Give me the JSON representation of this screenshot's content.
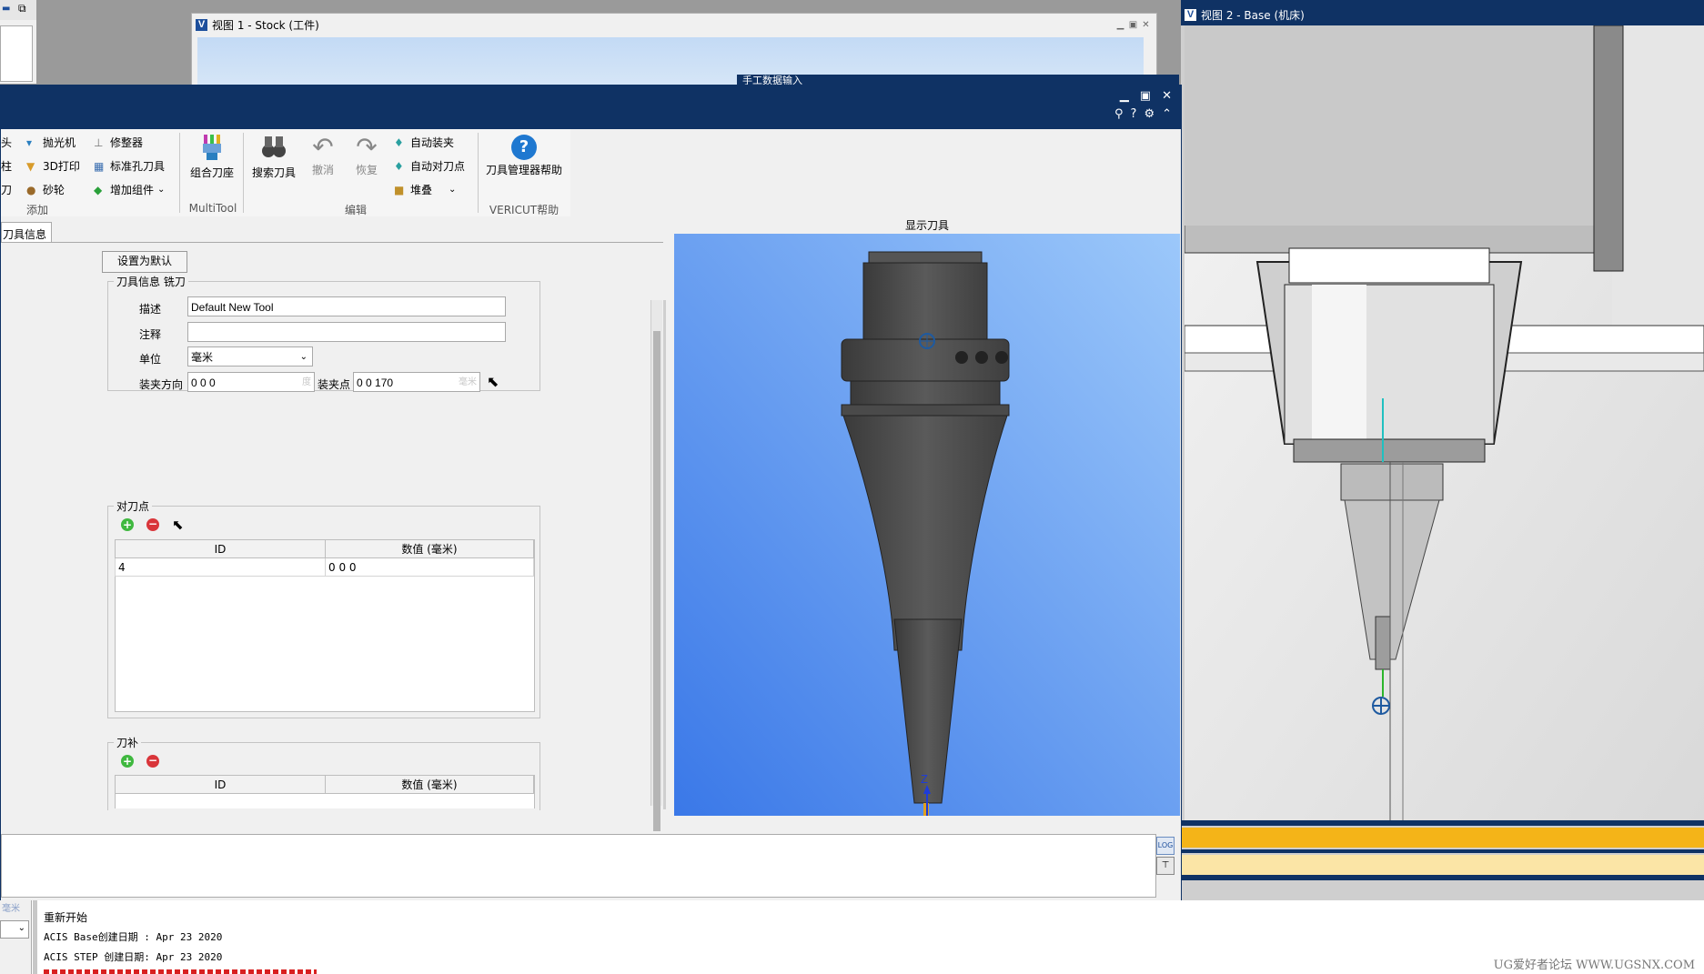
{
  "background_window_view1": {
    "title": "视图 1 - Stock (工件)"
  },
  "background_window_behind": {
    "title": "手工数据输入"
  },
  "view2": {
    "title": "视图 2 - Base (机床)"
  },
  "tool_manager": {
    "toolbar": {
      "group_add": {
        "label": "添加",
        "items": [
          "头",
          "柱",
          "刀",
          "抛光机",
          "3D打印",
          "砂轮",
          "修整器",
          "标准孔刀具",
          "增加组件"
        ]
      },
      "group_multitool": {
        "label": "MultiTool",
        "combo_holder": "组合刀座"
      },
      "group_edit": {
        "label": "编辑",
        "search_tool": "搜索刀具",
        "undo": "撤消",
        "redo": "恢复",
        "auto_mount": "自动装夹",
        "auto_tool_point": "自动对刀点",
        "stack": "堆叠"
      },
      "group_help": {
        "label": "VERICUT帮助",
        "tool_manager_help": "刀具管理器帮助"
      }
    },
    "tab_tool_info": "刀具信息",
    "set_default_button": "设置为默认",
    "tool_info_group": {
      "legend": "刀具信息 铣刀",
      "description_label": "描述",
      "description_value": "Default New Tool",
      "comment_label": "注释",
      "comment_value": "",
      "unit_label": "单位",
      "unit_value": "毫米",
      "mount_dir_label": "装夹方向",
      "mount_dir_value": "0 0 0",
      "mount_dir_unit": "度",
      "mount_point_label": "装夹点",
      "mount_point_value": "0 0 170",
      "mount_point_unit": "毫米"
    },
    "tool_point_group": {
      "legend": "对刀点",
      "columns": [
        "ID",
        "数值 (毫米)"
      ],
      "rows": [
        [
          "4",
          "0 0 0"
        ]
      ]
    },
    "tool_comp_group": {
      "legend": "刀补",
      "columns": [
        "ID",
        "数值 (毫米)"
      ],
      "rows": []
    },
    "display_tool_label": "显示刀具",
    "axis_z": "Z",
    "axis_x": "X"
  },
  "log": {
    "lines": [
      "重新开始",
      "ACIS Base创建日期 : Apr 23 2020",
      "ACIS STEP 创建日期: Apr 23 2020"
    ],
    "cut_unit": "毫米"
  },
  "watermark": "UG爱好者论坛 WWW.UGSNX.COM",
  "colors": {
    "titlebar_dark": "#0f3264",
    "viewport_blue_top": "#9cc8fa",
    "viewport_blue_bottom": "#3a78e8",
    "machine_gray": "#d8d8d8",
    "yellow_stripe": "#f4b418"
  }
}
